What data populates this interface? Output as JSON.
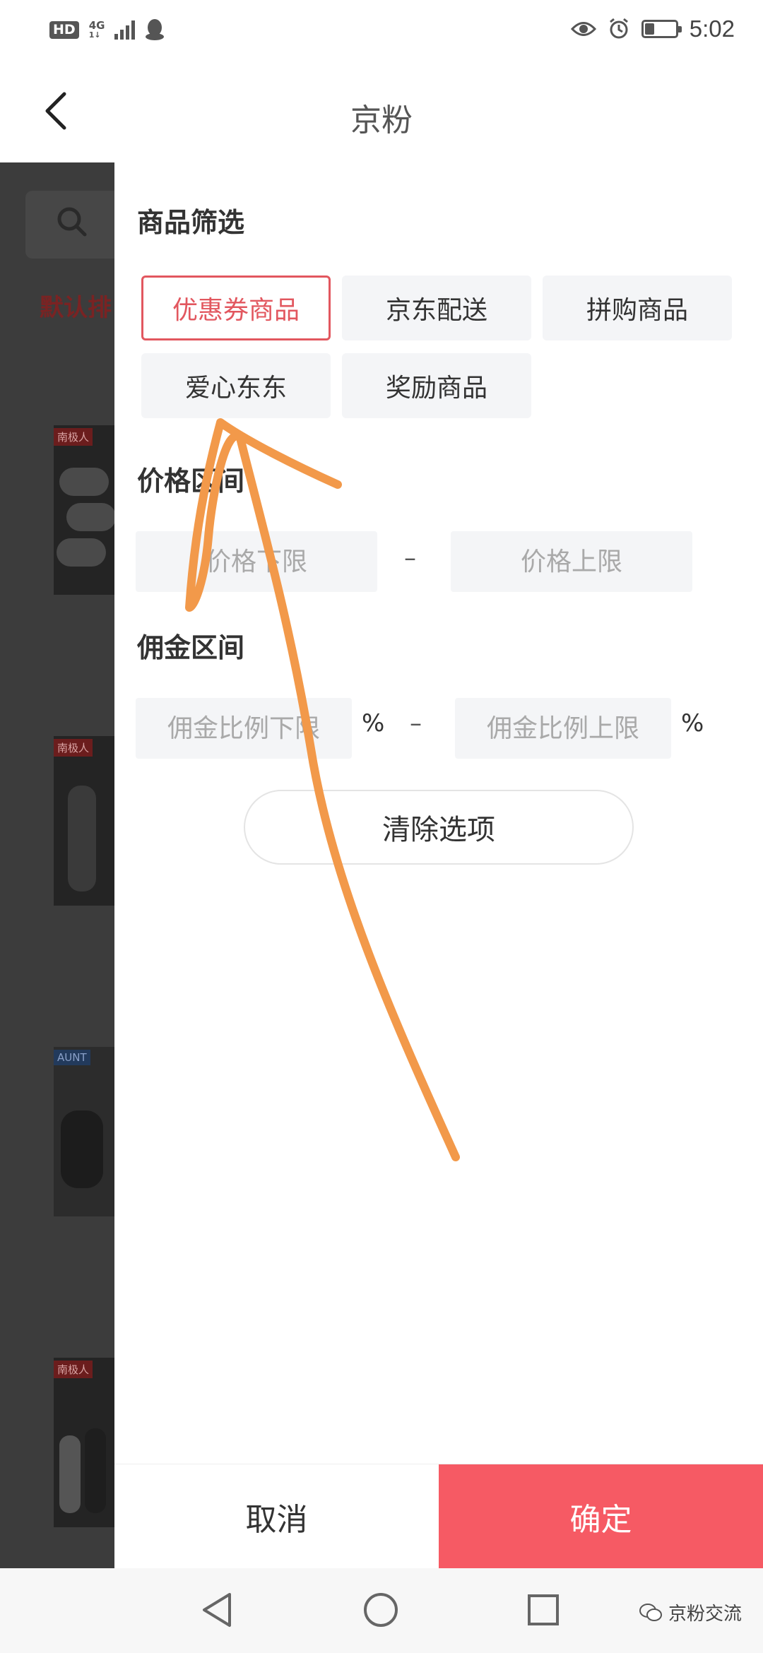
{
  "status_bar": {
    "hd": "HD",
    "network": "4G",
    "network_sub": "1↓",
    "time": "5:02",
    "battery_level": 0.3
  },
  "header": {
    "title": "京粉",
    "back_icon": "chevron-left-icon"
  },
  "background_page": {
    "sort_label": "默认排",
    "brands": [
      "南极人",
      "南极人",
      "AUNT",
      "南极人"
    ]
  },
  "filter": {
    "goods_section_title": "商品筛选",
    "chips": [
      {
        "label": "优惠券商品",
        "active": true
      },
      {
        "label": "京东配送",
        "active": false
      },
      {
        "label": "拼购商品",
        "active": false
      },
      {
        "label": "爱心东东",
        "active": false
      },
      {
        "label": "奖励商品",
        "active": false
      }
    ],
    "price_section_title": "价格区间",
    "price_min_placeholder": "价格下限",
    "price_max_placeholder": "价格上限",
    "price_separator": "–",
    "commission_section_title": "佣金区间",
    "commission_min_placeholder": "佣金比例下限",
    "commission_max_placeholder": "佣金比例上限",
    "commission_separator": "–",
    "percent_sign": "%",
    "clear_label": "清除选项"
  },
  "actions": {
    "cancel_label": "取消",
    "confirm_label": "确定"
  },
  "colors": {
    "accent": "#e2575f",
    "confirm_bg": "#f65a64",
    "annotation": "#f2994a"
  },
  "watermark": {
    "text": "京粉交流",
    "icon": "wechat-icon"
  }
}
